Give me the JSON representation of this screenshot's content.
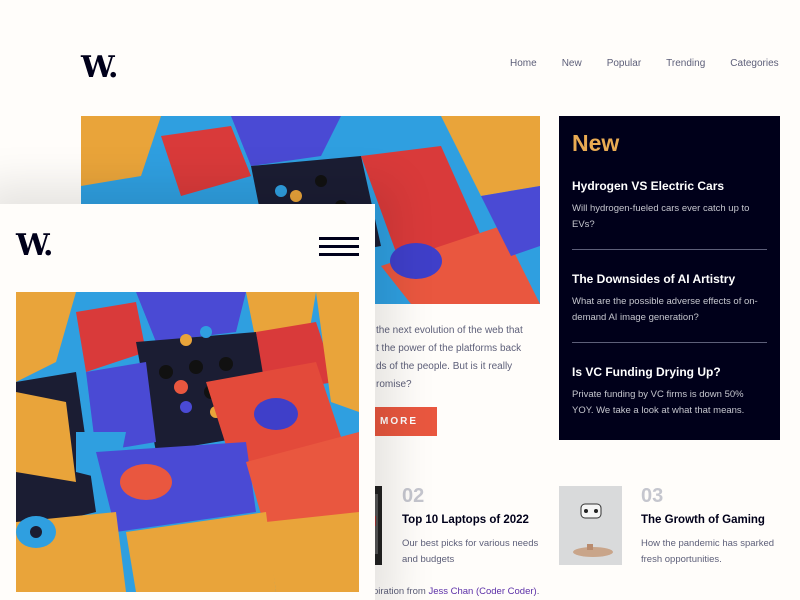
{
  "site": {
    "logo": "W."
  },
  "nav": {
    "items": [
      "Home",
      "New",
      "Popular",
      "Trending",
      "Categories"
    ]
  },
  "hero": {
    "description_lines": [
      "the next evolution of the web that",
      "t the power of the platforms back",
      "ds of the people. But is it really",
      "romise?"
    ],
    "read_more_label": "MORE"
  },
  "new_panel": {
    "title": "New",
    "items": [
      {
        "title": "Hydrogen VS Electric Cars",
        "description": "Will hydrogen-fueled cars ever catch up to EVs?"
      },
      {
        "title": "The Downsides of AI Artistry",
        "description": "What are the possible adverse effects of on-demand AI image generation?"
      },
      {
        "title": "Is VC Funding Drying Up?",
        "description": "Private funding by VC firms is down 50% YOY. We take a look at what that means."
      }
    ]
  },
  "articles": [
    {
      "number": "02",
      "title": "Top 10 Laptops of 2022",
      "description": "Our best picks for various needs and budgets"
    },
    {
      "number": "03",
      "title": "The Growth of Gaming",
      "description": "How the pandemic has sparked fresh opportunities."
    }
  ],
  "attribution": {
    "prefix": "piration from ",
    "author": "Jess Chan (Coder Coder)",
    "suffix": "."
  },
  "colors": {
    "dark": "#00001a",
    "accent_red": "#e9573f",
    "accent_orange": "#e9ab53",
    "grey_blue": "#5d5f79",
    "off_white": "#fffdfa"
  },
  "icons": {
    "menu": "hamburger-menu-icon"
  }
}
